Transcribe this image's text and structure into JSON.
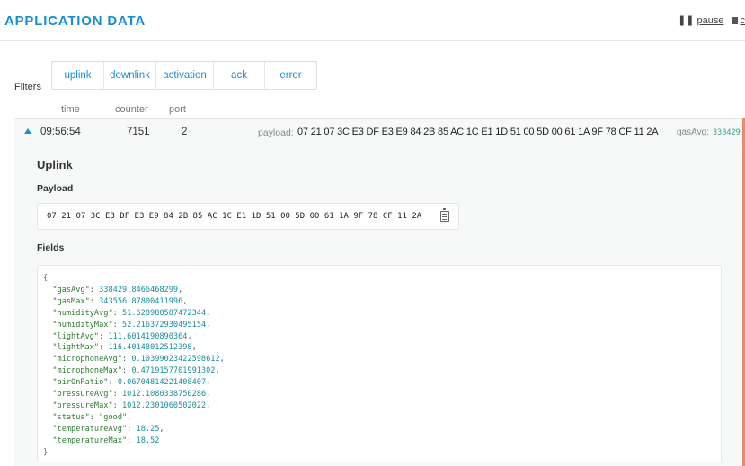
{
  "header": {
    "title": "APPLICATION DATA",
    "pause_label": "pause",
    "clear_label": "c"
  },
  "filters": {
    "label": "Filters",
    "buttons": [
      "uplink",
      "downlink",
      "activation",
      "ack",
      "error"
    ]
  },
  "columns": {
    "time": "time",
    "counter": "counter",
    "port": "port"
  },
  "row": {
    "time": "09:56:54",
    "counter": "7151",
    "port": "2",
    "payload_label": "payload:",
    "payload": "07 21 07 3C E3 DF E3 E9 84 2B 85 AC 1C E1 1D 51 00 5D 00 61 1A 9F 78 CF 11 2A",
    "gasavg_label": "gasAvg:",
    "gasavg_value": "338429."
  },
  "detail": {
    "heading": "Uplink",
    "payload_heading": "Payload",
    "payload_hex": "07 21 07 3C E3 DF E3 E9 84 2B 85 AC 1C E1 1D 51 00 5D 00 61 1A 9F 78 CF 11 2A",
    "fields_heading": "Fields",
    "fields": [
      {
        "key": "gasAvg",
        "value": "338429.8466468299",
        "type": "num"
      },
      {
        "key": "gasMax",
        "value": "343556.87800411996",
        "type": "num"
      },
      {
        "key": "humidityAvg",
        "value": "51.628980587472344",
        "type": "num"
      },
      {
        "key": "humidityMax",
        "value": "52.216372930495154",
        "type": "num"
      },
      {
        "key": "lightAvg",
        "value": "111.6014190890364",
        "type": "num"
      },
      {
        "key": "lightMax",
        "value": "116.40148012512398",
        "type": "num"
      },
      {
        "key": "microphoneAvg",
        "value": "0.10399023422598612",
        "type": "num"
      },
      {
        "key": "microphoneMax",
        "value": "0.4719157701991302",
        "type": "num"
      },
      {
        "key": "pirOnRatio",
        "value": "0.06704814221408407",
        "type": "num"
      },
      {
        "key": "pressureAvg",
        "value": "1012.1080338750286",
        "type": "num"
      },
      {
        "key": "pressureMax",
        "value": "1012.2301060502022",
        "type": "num"
      },
      {
        "key": "status",
        "value": "\"good\"",
        "type": "str"
      },
      {
        "key": "temperatureAvg",
        "value": "18.25",
        "type": "num"
      },
      {
        "key": "temperatureMax",
        "value": "18.52",
        "type": "num"
      }
    ]
  }
}
